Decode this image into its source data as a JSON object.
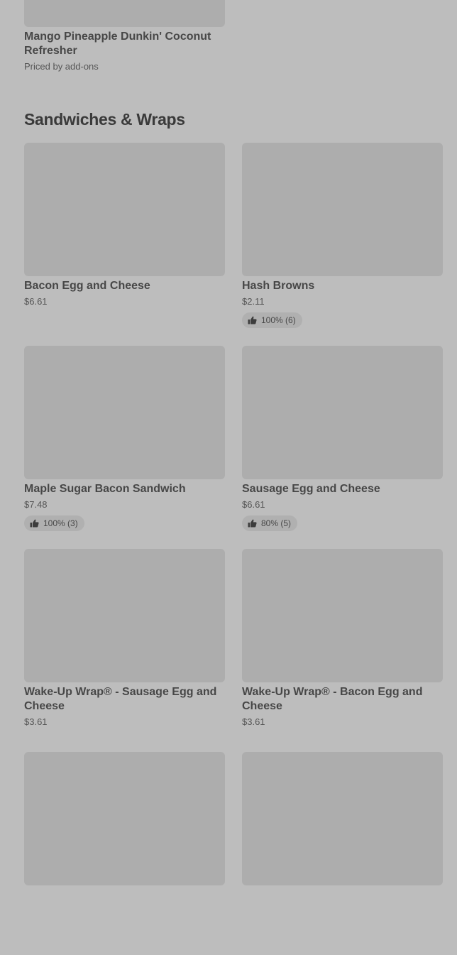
{
  "previous_item": {
    "title": "Mango Pineapple Dunkin' Coconut Refresher",
    "price": "Priced by add-ons"
  },
  "section": {
    "title": "Sandwiches & Wraps"
  },
  "items": [
    {
      "title": "Bacon Egg and Cheese",
      "price": "$6.61"
    },
    {
      "title": "Hash Browns",
      "price": "$2.11",
      "rating": "100% (6)"
    },
    {
      "title": "Maple Sugar Bacon Sandwich",
      "price": "$7.48",
      "rating": "100% (3)"
    },
    {
      "title": "Sausage Egg and Cheese",
      "price": "$6.61",
      "rating": "80% (5)"
    },
    {
      "title": "Wake-Up Wrap® - Sausage Egg and Cheese",
      "price": "$3.61"
    },
    {
      "title": "Wake-Up Wrap® - Bacon Egg and Cheese",
      "price": "$3.61"
    }
  ],
  "icons": {
    "rating": "thumbs-up-icon"
  }
}
